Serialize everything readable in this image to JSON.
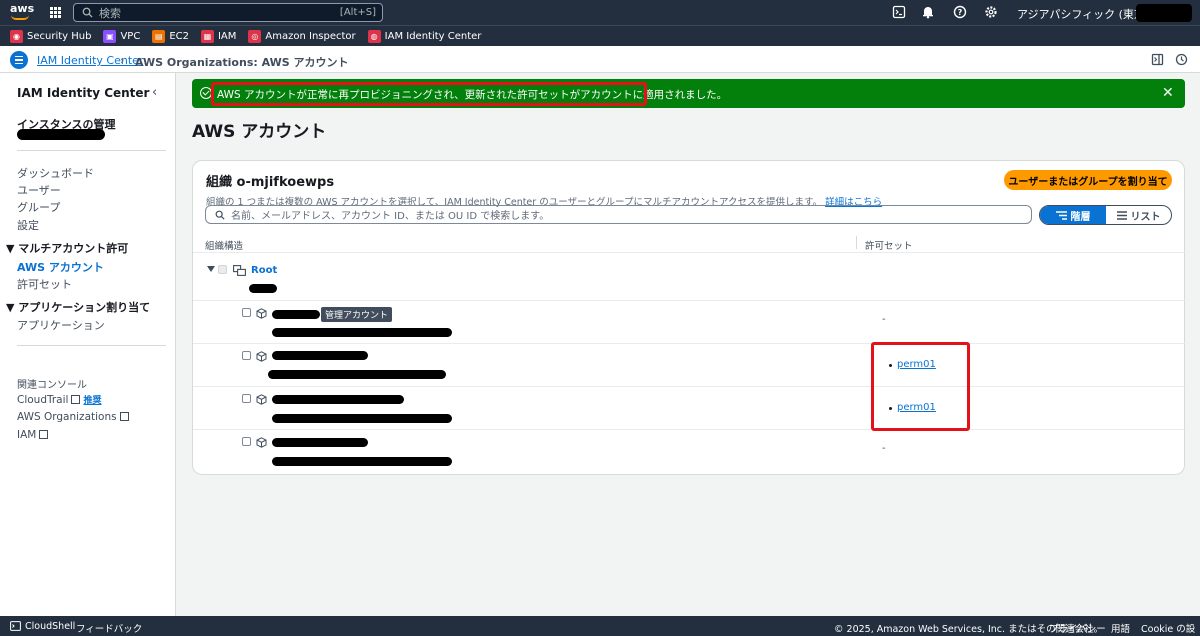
{
  "topnav": {
    "search_placeholder": "検索",
    "search_shortcut": "[Alt+S]",
    "region": "アジアパシフィック (東京) ▾"
  },
  "favorites": [
    {
      "label": "Security Hub",
      "color": "#dd344c",
      "glyph": "◉"
    },
    {
      "label": "VPC",
      "color": "#8c4fff",
      "glyph": "▣"
    },
    {
      "label": "EC2",
      "color": "#ed7100",
      "glyph": "▤"
    },
    {
      "label": "IAM",
      "color": "#dd344c",
      "glyph": "▦"
    },
    {
      "label": "Amazon Inspector",
      "color": "#dd344c",
      "glyph": "◎"
    },
    {
      "label": "IAM Identity Center",
      "color": "#dd344c",
      "glyph": "◍"
    }
  ],
  "breadcrumb": {
    "parent": "IAM Identity Center",
    "separator": "›",
    "current": "AWS Organizations: AWS アカウント"
  },
  "sidebar": {
    "title": "IAM Identity Center",
    "collapse": "‹",
    "instance_label": "インスタンスの管理",
    "items": [
      "ダッシュボード",
      "ユーザー",
      "グループ",
      "設定"
    ],
    "section_multi": "▼ マルチアカウント許可",
    "multi_items": [
      "AWS アカウント",
      "許可セット"
    ],
    "section_app": "▼ アプリケーション割り当て",
    "app_items": [
      "アプリケーション"
    ],
    "related_title": "関連コンソール",
    "related": [
      "CloudTrail",
      "AWS Organizations",
      "IAM"
    ],
    "new_badge": "推奨"
  },
  "flash": {
    "message": "AWS アカウントが正常に再プロビジョニングされ、更新された許可セットがアカウントに適用されました。",
    "close": "✕",
    "color": "#037f0c"
  },
  "page": {
    "title": "AWS アカウント"
  },
  "panel": {
    "org_title": "組織 o-mjifkoewps",
    "assign_button": "ユーザーまたはグループを割り当て",
    "description": "組織の 1 つまたは複数の AWS アカウントを選択して、IAM Identity Center のユーザーとグループにマルチアカウントアクセスを提供します。",
    "learn_more": "詳細はこちら",
    "search_placeholder": "名前、メールアドレス、アカウント ID、または OU ID で検索します。",
    "view_hierarchy": "階層",
    "view_list": "リスト",
    "col_structure": "組織構造",
    "col_permsets": "許可セット",
    "root_label": "Root",
    "mgmt_tag": "管理アカウント",
    "rows": [
      {
        "perm": "-"
      },
      {
        "perm": "perm01"
      },
      {
        "perm": "perm01"
      },
      {
        "perm": "-"
      }
    ]
  },
  "footer": {
    "cloudshell": "CloudShell",
    "feedback": "フィードバック",
    "copyright": "© 2025, Amazon Web Services, Inc. またはその関連会社。",
    "privacy": "プライバシー",
    "terms": "用語",
    "cookie": "Cookie の設定"
  }
}
